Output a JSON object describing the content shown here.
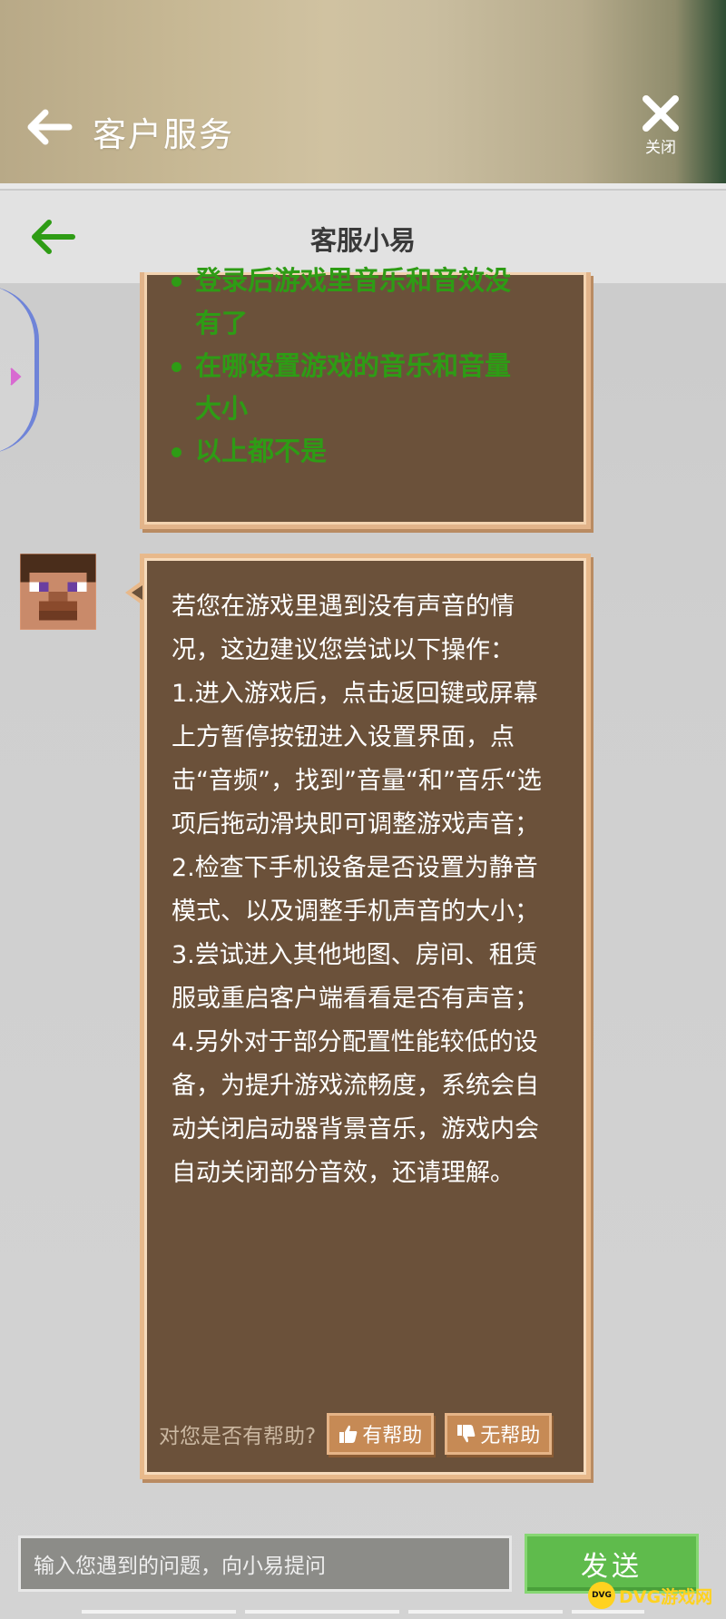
{
  "outer_header": {
    "title": "客户服务",
    "close_label": "关闭",
    "back_icon": "arrow-left-icon",
    "close_icon": "close-icon"
  },
  "inner_header": {
    "title": "客服小易",
    "back_icon": "arrow-left-icon",
    "accent": "#2e9c15"
  },
  "suggestions": {
    "items": [
      "登录后游戏里音乐和音效没有了",
      "在哪设置游戏的音乐和音量大小",
      "以上都不是"
    ]
  },
  "reply": {
    "avatar_icon": "pixel-steve-avatar-icon",
    "text": "若您在游戏里遇到没有声音的情况，这边建议您尝试以下操作：\n1.进入游戏后，点击返回键或屏幕上方暂停按钮进入设置界面，点击“音频”，找到”音量“和”音乐“选项后拖动滑块即可调整游戏声音；\n2.检查下手机设备是否设置为静音模式、以及调整手机声音的大小；\n3.尝试进入其他地图、房间、租赁服或重启客户端看看是否有声音；\n4.另外对于部分配置性能较低的设备，为提升游戏流畅度，系统会自动关闭启动器背景音乐，游戏内会自动关闭部分音效，还请理解。",
    "feedback_question": "对您是否有帮助?",
    "helpful_label": "有帮助",
    "not_helpful_label": "无帮助"
  },
  "composer": {
    "placeholder": "输入您遇到的问题，向小易提问",
    "send_label": "发送"
  },
  "watermark": {
    "badge": "DVG",
    "text": "DVG游戏网"
  }
}
